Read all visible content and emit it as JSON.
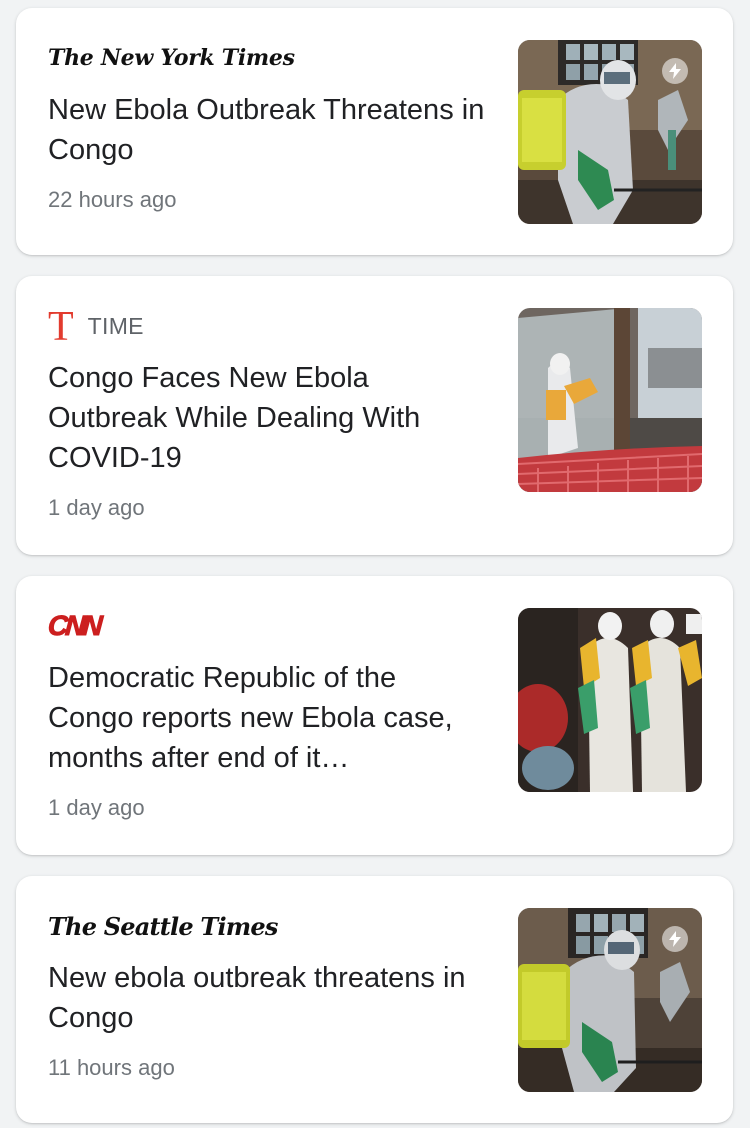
{
  "articles": [
    {
      "source": "The New York Times",
      "headline": "New Ebola Outbreak Threatens in Congo",
      "time": "22 hours ago",
      "amp": true,
      "thumbnail_icon": "ebola-sprayer-photo"
    },
    {
      "source_logo": "T",
      "source": "TIME",
      "headline": "Congo Faces New Ebola Outbreak While Dealing With COVID-19",
      "time": "1 day ago",
      "amp": false,
      "thumbnail_icon": "ebola-treatment-tent-photo"
    },
    {
      "source": "CNN",
      "headline": "Democratic Republic of the Congo reports new Ebola case, months after end of it…",
      "time": "1 day ago",
      "amp": false,
      "thumbnail_icon": "health-workers-ppe-photo"
    },
    {
      "source": "The Seattle Times",
      "headline": "New ebola outbreak threatens in Congo",
      "time": "11 hours ago",
      "amp": true,
      "thumbnail_icon": "ebola-sprayer-photo"
    }
  ],
  "colors": {
    "background": "#f1f3f4",
    "card": "#ffffff",
    "headline": "#202124",
    "meta": "#70757a",
    "time_red": "#e23b2e",
    "cnn_red": "#cc1f1f"
  }
}
